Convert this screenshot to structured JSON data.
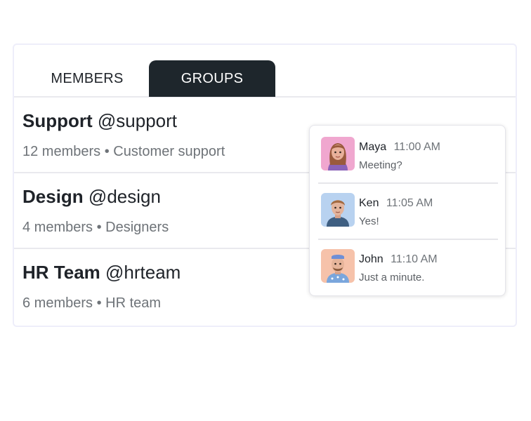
{
  "tabs": {
    "members_label": "MEMBERS",
    "groups_label": "GROUPS",
    "active": "GROUPS"
  },
  "groups": [
    {
      "name": "Support",
      "handle": "@support",
      "members": "12 members",
      "description": "Customer support"
    },
    {
      "name": "Design",
      "handle": "@design",
      "members": "4 members",
      "description": "Designers"
    },
    {
      "name": "HR Team",
      "handle": "@hrteam",
      "members": "6 members",
      "description": "HR team"
    }
  ],
  "separator": "•",
  "messages": [
    {
      "name": "Maya",
      "time": "11:00 AM",
      "text": "Meeting?",
      "avatar": "avatar-maya-icon"
    },
    {
      "name": "Ken",
      "time": "11:05 AM",
      "text": "Yes!",
      "avatar": "avatar-ken-icon"
    },
    {
      "name": "John",
      "time": "11:10 AM",
      "text": "Just a minute.",
      "avatar": "avatar-john-icon"
    }
  ],
  "colors": {
    "active_tab_bg": "#1e262c",
    "text_primary": "#1f2329",
    "text_secondary": "#6e7378",
    "divider": "#e9e9ee"
  }
}
